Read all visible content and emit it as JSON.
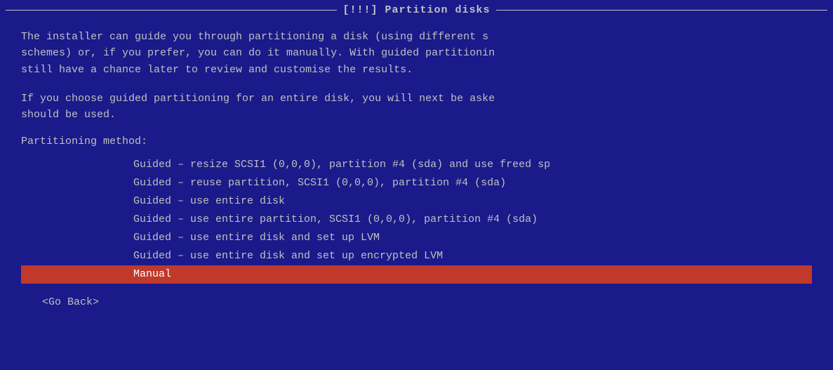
{
  "title": "[!!!] Partition disks",
  "paragraphs": {
    "p1": "The installer can guide you through partitioning a disk (using different s\nschemes) or, if you prefer, you can do it manually. With guided partitionin\nstill have a chance later to review and customise the results.",
    "p2": "If you choose guided partitioning for an entire disk, you will next be aske\nshould be used."
  },
  "section_label": "Partitioning method:",
  "menu_items": [
    {
      "label": "Guided – resize SCSI1 (0,0,0), partition #4 (sda) and use freed sp",
      "selected": false
    },
    {
      "label": "Guided – reuse partition, SCSI1 (0,0,0), partition #4 (sda)",
      "selected": false
    },
    {
      "label": "Guided – use entire disk",
      "selected": false
    },
    {
      "label": "Guided – use entire partition, SCSI1 (0,0,0), partition #4 (sda)",
      "selected": false
    },
    {
      "label": "Guided – use entire disk and set up LVM",
      "selected": false
    },
    {
      "label": "Guided – use entire disk and set up encrypted LVM",
      "selected": false
    },
    {
      "label": "Manual",
      "selected": true
    }
  ],
  "go_back": "<Go Back>"
}
